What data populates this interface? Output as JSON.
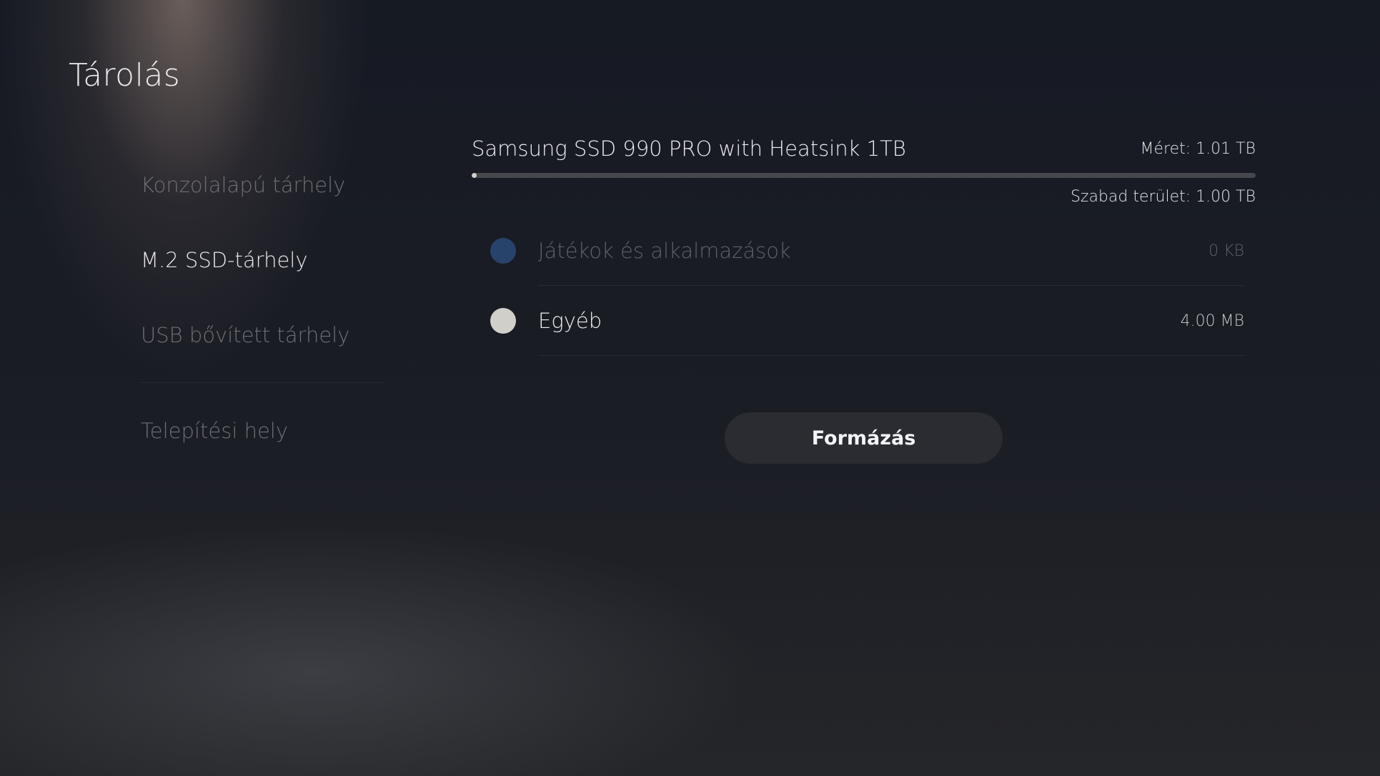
{
  "screen": {
    "title": "Tárolás"
  },
  "sidebar": {
    "items": [
      {
        "label": "Konzolalapú tárhely",
        "active": false
      },
      {
        "label": "M.2 SSD-tárhely",
        "active": true
      },
      {
        "label": "USB bővített tárhely",
        "active": false
      }
    ],
    "secondary": {
      "label": "Telepítési hely"
    }
  },
  "drive": {
    "name": "Samsung SSD 990 PRO with Heatsink 1TB",
    "size": "Méret: 1.01 TB",
    "free": "Szabad terület: 1.00 TB",
    "used_fraction": 0.004,
    "bar_color": "#d0cfcc",
    "track_color": "#45474d"
  },
  "categories": [
    {
      "label": "Játékok és alkalmazások",
      "value": "0 KB",
      "color": "#2c4a78"
    },
    {
      "label": "Egyéb",
      "value": "4.00 MB",
      "color": "#d1cfca"
    }
  ],
  "actions": {
    "format_label": "Formázás"
  }
}
